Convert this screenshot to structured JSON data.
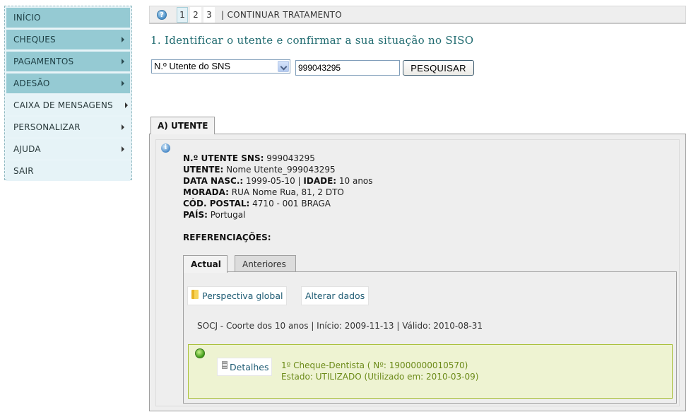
{
  "sidebar": {
    "items": [
      {
        "label": "INÍCIO",
        "has_submenu": false,
        "style": "dark"
      },
      {
        "label": "CHEQUES",
        "has_submenu": true,
        "style": "dark"
      },
      {
        "label": "PAGAMENTOS",
        "has_submenu": true,
        "style": "dark"
      },
      {
        "label": "ADESÃO",
        "has_submenu": true,
        "style": "dark"
      },
      {
        "label": "CAIXA DE MENSAGENS",
        "has_submenu": true,
        "style": "light"
      },
      {
        "label": "PERSONALIZAR",
        "has_submenu": true,
        "style": "light"
      },
      {
        "label": "AJUDA",
        "has_submenu": true,
        "style": "light"
      },
      {
        "label": "SAIR",
        "has_submenu": false,
        "style": "light"
      }
    ]
  },
  "stepbar": {
    "help_icon": "question-circle-icon",
    "steps": [
      "1",
      "2",
      "3"
    ],
    "active_step": "1",
    "continue_label": "| CONTINUAR TRATAMENTO"
  },
  "page_title": "1. Identificar o utente e confirmar a sua situação no SISO",
  "search": {
    "type_selected": "N.º Utente do SNS",
    "value": "999043295",
    "button_label": "PESQUISAR"
  },
  "utente_tab": {
    "label": "A) UTENTE",
    "fields": {
      "sns_label": "N.º UTENTE SNS:",
      "sns_value": " 999043295",
      "name_label": "UTENTE:",
      "name_value": " Nome Utente_999043295",
      "birth_label": "DATA NASC.:",
      "birth_value": " 1999-05-10 | ",
      "age_label": "IDADE:",
      "age_value": " 10 anos",
      "address_label": "MORADA:",
      "address_value": " RUA Nome Rua, 81, 2 DTO",
      "postal_label": "CÓD. POSTAL:",
      "postal_value": " 4710 - 001 BRAGA",
      "country_label": "PAÍS:",
      "country_value": " Portugal"
    },
    "refs_label": "REFERENCIAÇÕES:"
  },
  "referrals": {
    "tabs": [
      "Actual",
      "Anteriores"
    ],
    "active_tab": "Actual",
    "actions": {
      "global_view": "Perspectiva global",
      "edit_data": "Alterar dados"
    },
    "summary": "SOCJ - Coorte dos 10 anos | Início: 2009-11-13 | Válido: 2010-08-31",
    "cheque": {
      "details_label": "Detalhes",
      "title": "1º Cheque-Dentista ( Nº: 19000000010570)",
      "status": "Estado: UTILIZADO (Utilizado em: 2010-03-09)",
      "status_color": "#6b8a18"
    }
  }
}
